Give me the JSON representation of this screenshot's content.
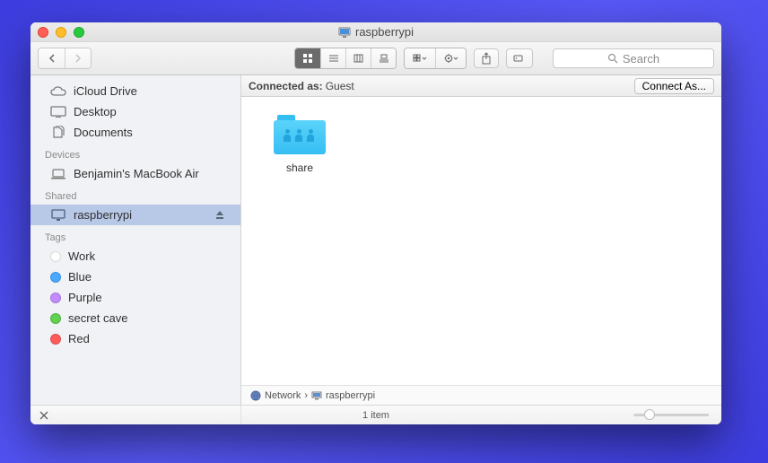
{
  "window": {
    "title": "raspberrypi"
  },
  "search": {
    "placeholder": "Search"
  },
  "sidebar": {
    "favorites": [
      {
        "name": "iCloud Drive",
        "icon": "cloud"
      },
      {
        "name": "Desktop",
        "icon": "desktop"
      },
      {
        "name": "Documents",
        "icon": "documents"
      }
    ],
    "devices_header": "Devices",
    "devices": [
      {
        "name": "Benjamin's MacBook Air",
        "icon": "laptop"
      }
    ],
    "shared_header": "Shared",
    "shared": [
      {
        "name": "raspberrypi",
        "icon": "monitor",
        "selected": true
      }
    ],
    "tags_header": "Tags",
    "tags": [
      {
        "name": "Work",
        "color": "#ffffff"
      },
      {
        "name": "Blue",
        "color": "#4aa9ff"
      },
      {
        "name": "Purple",
        "color": "#c28bff"
      },
      {
        "name": "secret cave",
        "color": "#61d24f"
      },
      {
        "name": "Red",
        "color": "#ff5b5b"
      }
    ]
  },
  "connection": {
    "label": "Connected as:",
    "value": "Guest",
    "button": "Connect As..."
  },
  "items": [
    {
      "name": "share"
    }
  ],
  "path": {
    "root": "Network",
    "current": "raspberrypi"
  },
  "status": {
    "text": "1 item"
  }
}
